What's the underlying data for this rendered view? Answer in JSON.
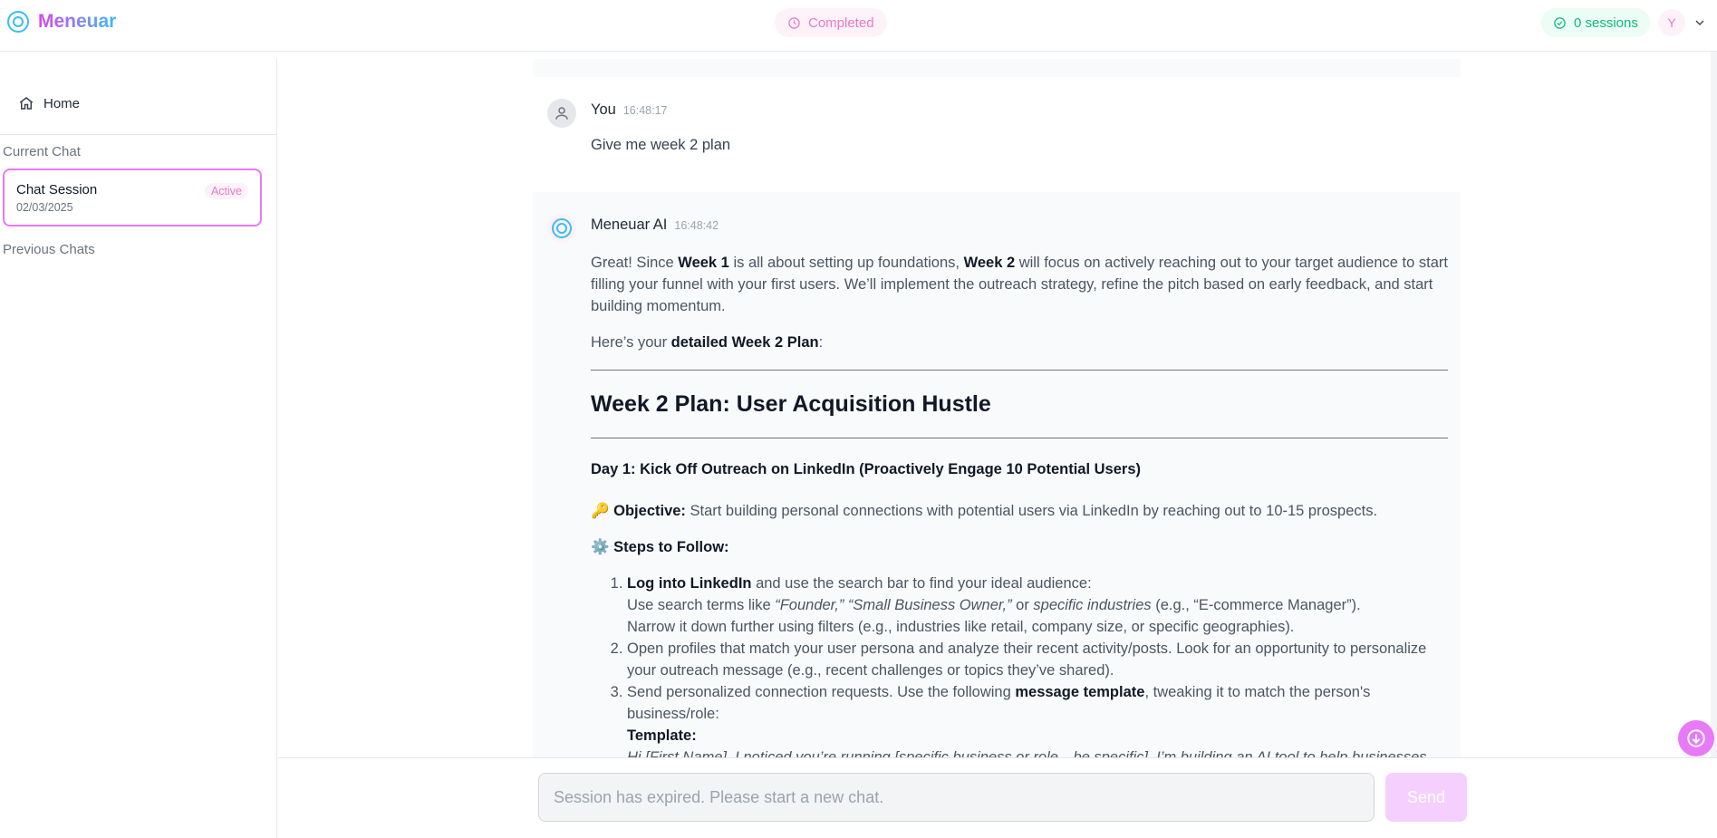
{
  "header": {
    "brand": "Meneuar",
    "status": "Completed",
    "sessions": "0 sessions",
    "avatar_initial": "Y"
  },
  "sidebar": {
    "home": "Home",
    "current_chat_label": "Current Chat",
    "current_chat": {
      "title": "Chat Session",
      "date": "02/03/2025",
      "badge": "Active"
    },
    "previous_chats_label": "Previous Chats"
  },
  "messages": {
    "user": {
      "name": "You",
      "time": "16:48:17",
      "text": "Give me week 2 plan"
    },
    "ai": {
      "name": "Meneuar AI",
      "time": "16:48:42",
      "intro_1": "Great! Since ",
      "intro_week1": "Week 1",
      "intro_2": " is all about setting up foundations, ",
      "intro_week2": "Week 2",
      "intro_3": " will focus on actively reaching out to your target audience to start filling your funnel with your first users. We’ll implement the outreach strategy, refine the pitch based on early feedback, and start building momentum.",
      "heres_1": "Here’s your ",
      "heres_bold": "detailed Week 2 Plan",
      "heres_2": ":",
      "heading": "Week 2 Plan: User Acquisition Hustle",
      "day1": "Day 1: Kick Off Outreach on LinkedIn (Proactively Engage 10 Potential Users)",
      "objective_icon": "🔑",
      "objective_label": "Objective:",
      "objective_text": " Start building personal connections with potential users via LinkedIn by reaching out to 10-15 prospects.",
      "steps_icon": "⚙️",
      "steps_label": "Steps to Follow:",
      "step1_bold": "Log into LinkedIn",
      "step1_rest": " and use the search bar to find your ideal audience:",
      "step1_line2_a": "Use search terms like ",
      "step1_line2_i1": "“Founder,” “Small Business Owner,”",
      "step1_line2_b": " or ",
      "step1_line2_i2": "specific industries",
      "step1_line2_c": " (e.g., “E-commerce Manager”).",
      "step1_line3": "Narrow it down further using filters (e.g., industries like retail, company size, or specific geographies).",
      "step2": "Open profiles that match your user persona and analyze their recent activity/posts. Look for an opportunity to personalize your outreach message (e.g., recent challenges or topics they’ve shared).",
      "step3_a": "Send personalized connection requests. Use the following ",
      "step3_bold": "message template",
      "step3_b": ", tweaking it to match the person's business/role:",
      "template_label": "Template:",
      "template_text": "Hi [First Name], I noticed you’re running [specific business or role—be specific]. I’m building an AI tool to help businesses like yours [specific problem it solves]. I’d love to hear your feedback if it sounds interesting—let me know if you’re open to trying it."
    }
  },
  "footer": {
    "input_placeholder": "Session has expired. Please start a new chat.",
    "send": "Send"
  },
  "icons": {
    "brand": "target-circle-icon",
    "status": "clock-icon",
    "sessions": "check-circle-icon",
    "home": "home-icon",
    "user_avatar": "user-icon",
    "scroll": "arrow-down-icon",
    "chevron": "chevron-down-icon"
  },
  "colors": {
    "accent_pink": "#e879f9",
    "accent_blue": "#38bdf8",
    "success_green": "#10b981"
  }
}
